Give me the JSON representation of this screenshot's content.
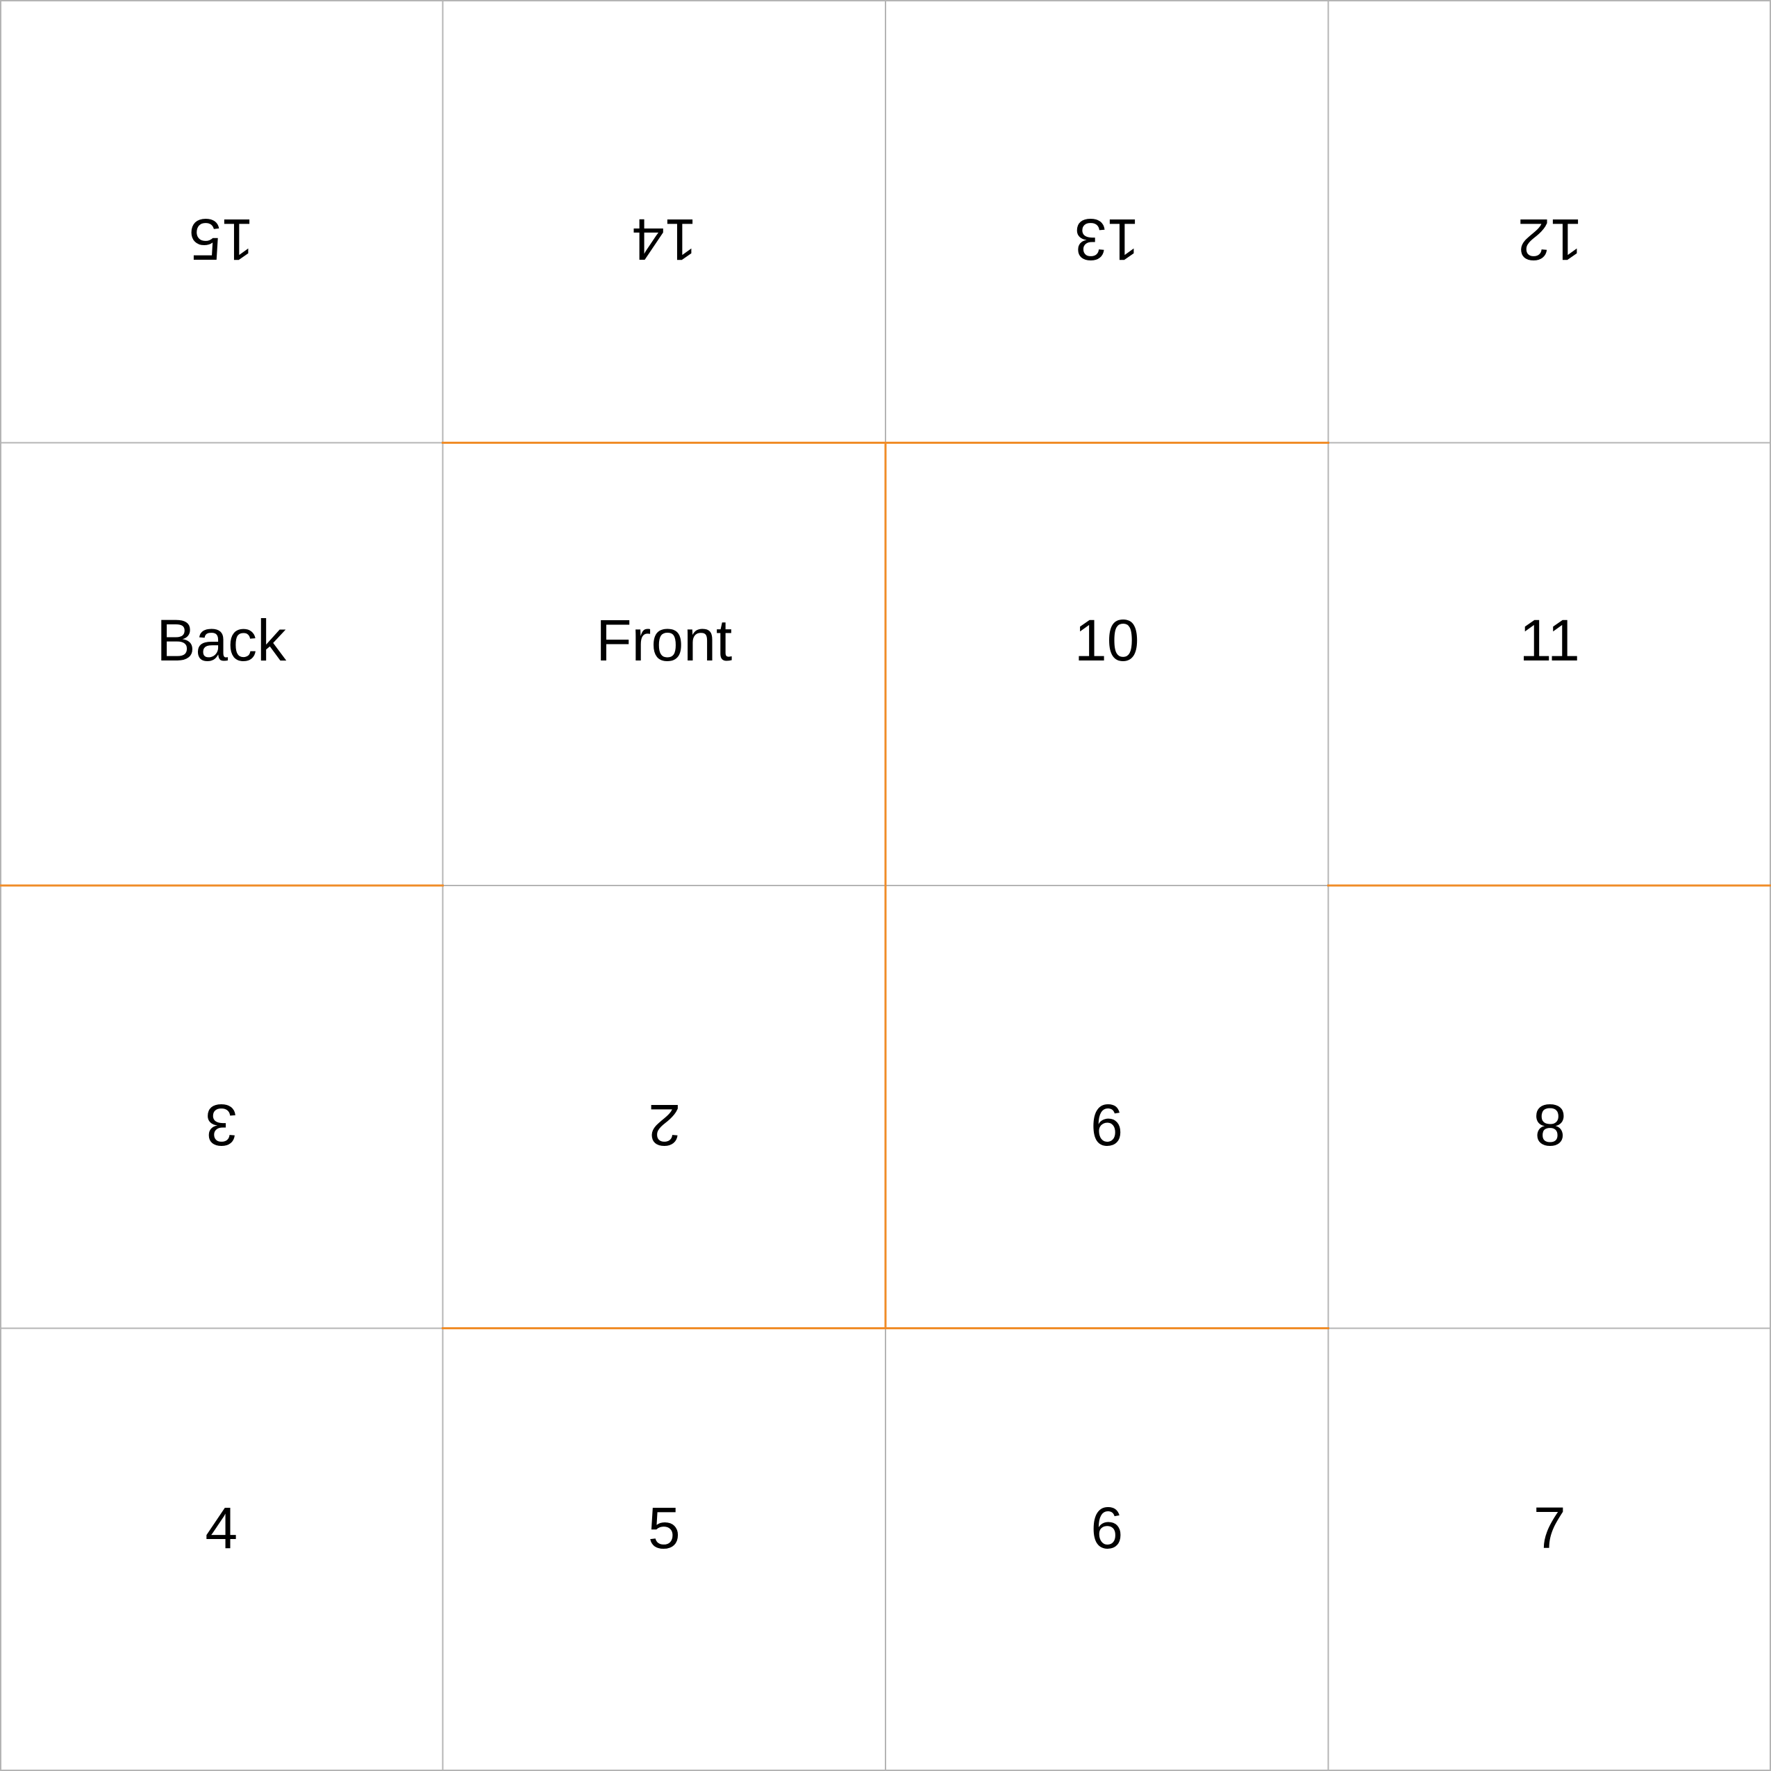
{
  "colors": {
    "grid_line": "#b4b4b4",
    "fold_line": "#f08c28",
    "text": "#000000",
    "background": "#ffffff"
  },
  "cells": [
    {
      "row": 0,
      "col": 0,
      "label": "15",
      "upside_down": true
    },
    {
      "row": 0,
      "col": 1,
      "label": "14",
      "upside_down": true
    },
    {
      "row": 0,
      "col": 2,
      "label": "13",
      "upside_down": true
    },
    {
      "row": 0,
      "col": 3,
      "label": "12",
      "upside_down": true
    },
    {
      "row": 1,
      "col": 0,
      "label": "Back",
      "upside_down": false
    },
    {
      "row": 1,
      "col": 1,
      "label": "Front",
      "upside_down": false
    },
    {
      "row": 1,
      "col": 2,
      "label": "10",
      "upside_down": false
    },
    {
      "row": 1,
      "col": 3,
      "label": "11",
      "upside_down": false
    },
    {
      "row": 2,
      "col": 0,
      "label": "3",
      "upside_down": true
    },
    {
      "row": 2,
      "col": 1,
      "label": "2",
      "upside_down": true
    },
    {
      "row": 2,
      "col": 2,
      "label": "9",
      "upside_down": true
    },
    {
      "row": 2,
      "col": 3,
      "label": "8",
      "upside_down": true
    },
    {
      "row": 3,
      "col": 0,
      "label": "4",
      "upside_down": false
    },
    {
      "row": 3,
      "col": 1,
      "label": "5",
      "upside_down": false
    },
    {
      "row": 3,
      "col": 2,
      "label": "6",
      "upside_down": false
    },
    {
      "row": 3,
      "col": 3,
      "label": "7",
      "upside_down": false
    }
  ],
  "fold_lines": [
    {
      "orientation": "horizontal",
      "at_row_boundary": 1,
      "from_col": 1,
      "to_col": 3
    },
    {
      "orientation": "horizontal",
      "at_row_boundary": 2,
      "from_col": 0,
      "to_col": 1
    },
    {
      "orientation": "horizontal",
      "at_row_boundary": 2,
      "from_col": 3,
      "to_col": 4
    },
    {
      "orientation": "horizontal",
      "at_row_boundary": 3,
      "from_col": 1,
      "to_col": 3
    },
    {
      "orientation": "vertical",
      "at_col_boundary": 2,
      "from_row": 1,
      "to_row": 3
    }
  ]
}
